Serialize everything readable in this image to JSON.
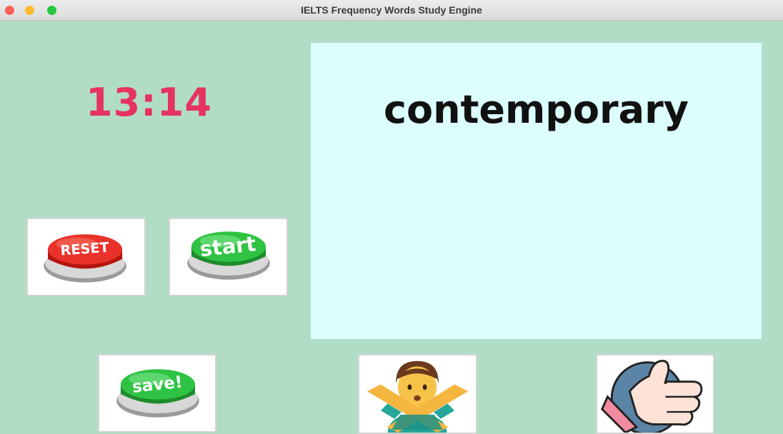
{
  "window": {
    "title": "IELTS Frequency Words Study Engine"
  },
  "timer": {
    "value": "13:14"
  },
  "word_panel": {
    "word": "contemporary"
  },
  "buttons": {
    "reset_label": "RESET",
    "start_label": "start",
    "save_label": "save!"
  },
  "icons": {
    "reject": "man-gesturing-no-icon",
    "approve": "thumbs-up-icon"
  },
  "colors": {
    "background": "#b1ddc6",
    "panel": "#dcfffe",
    "timer": "#e6335f",
    "reset_button": "#e8322a",
    "start_button": "#2fc344"
  }
}
